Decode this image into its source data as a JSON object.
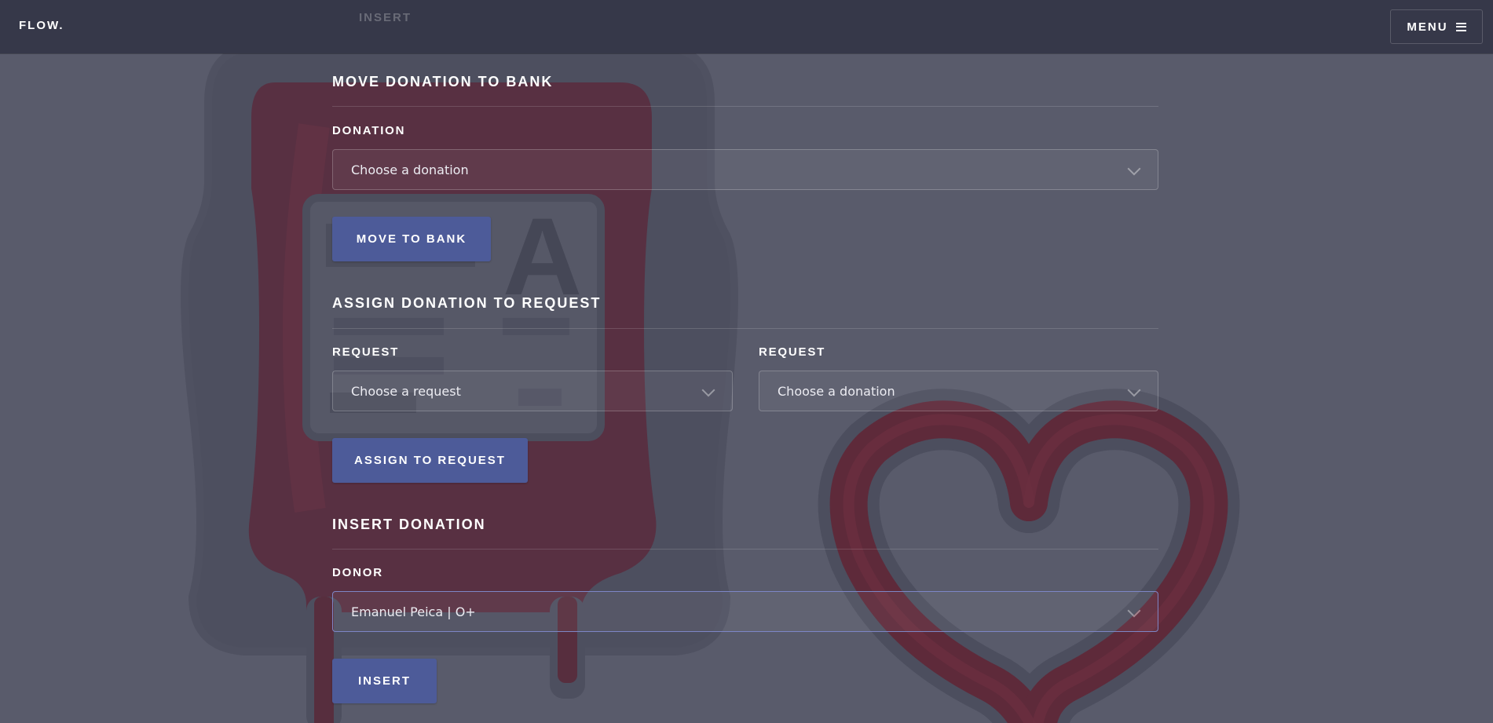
{
  "app": {
    "logo": "FLOW.",
    "menu_label": "MENU"
  },
  "ghost_header_text": "INSERT",
  "move_section": {
    "title": "MOVE DONATION TO BANK",
    "donation_label": "DONATION",
    "donation_value": "Choose a donation",
    "button_label": "MOVE TO BANK"
  },
  "assign_section": {
    "title": "ASSIGN DONATION TO REQUEST",
    "request_label": "REQUEST",
    "request_value": "Choose a request",
    "donation_label": "REQUEST",
    "donation_value": "Choose a donation",
    "button_label": "ASSIGN TO REQUEST"
  },
  "insert_section": {
    "title": "INSERT DONATION",
    "donor_label": "DONOR",
    "donor_value": "Emanuel Peica | O+",
    "button_label": "INSERT"
  },
  "colors": {
    "header_bg": "#363849",
    "page_bg": "#595b6b",
    "button_bg": "#4d5b99",
    "focus_border": "#7d86c6",
    "blood": "#6b2233"
  },
  "icons": {
    "menu": "hamburger-icon",
    "select": "chevron-down-icon"
  }
}
